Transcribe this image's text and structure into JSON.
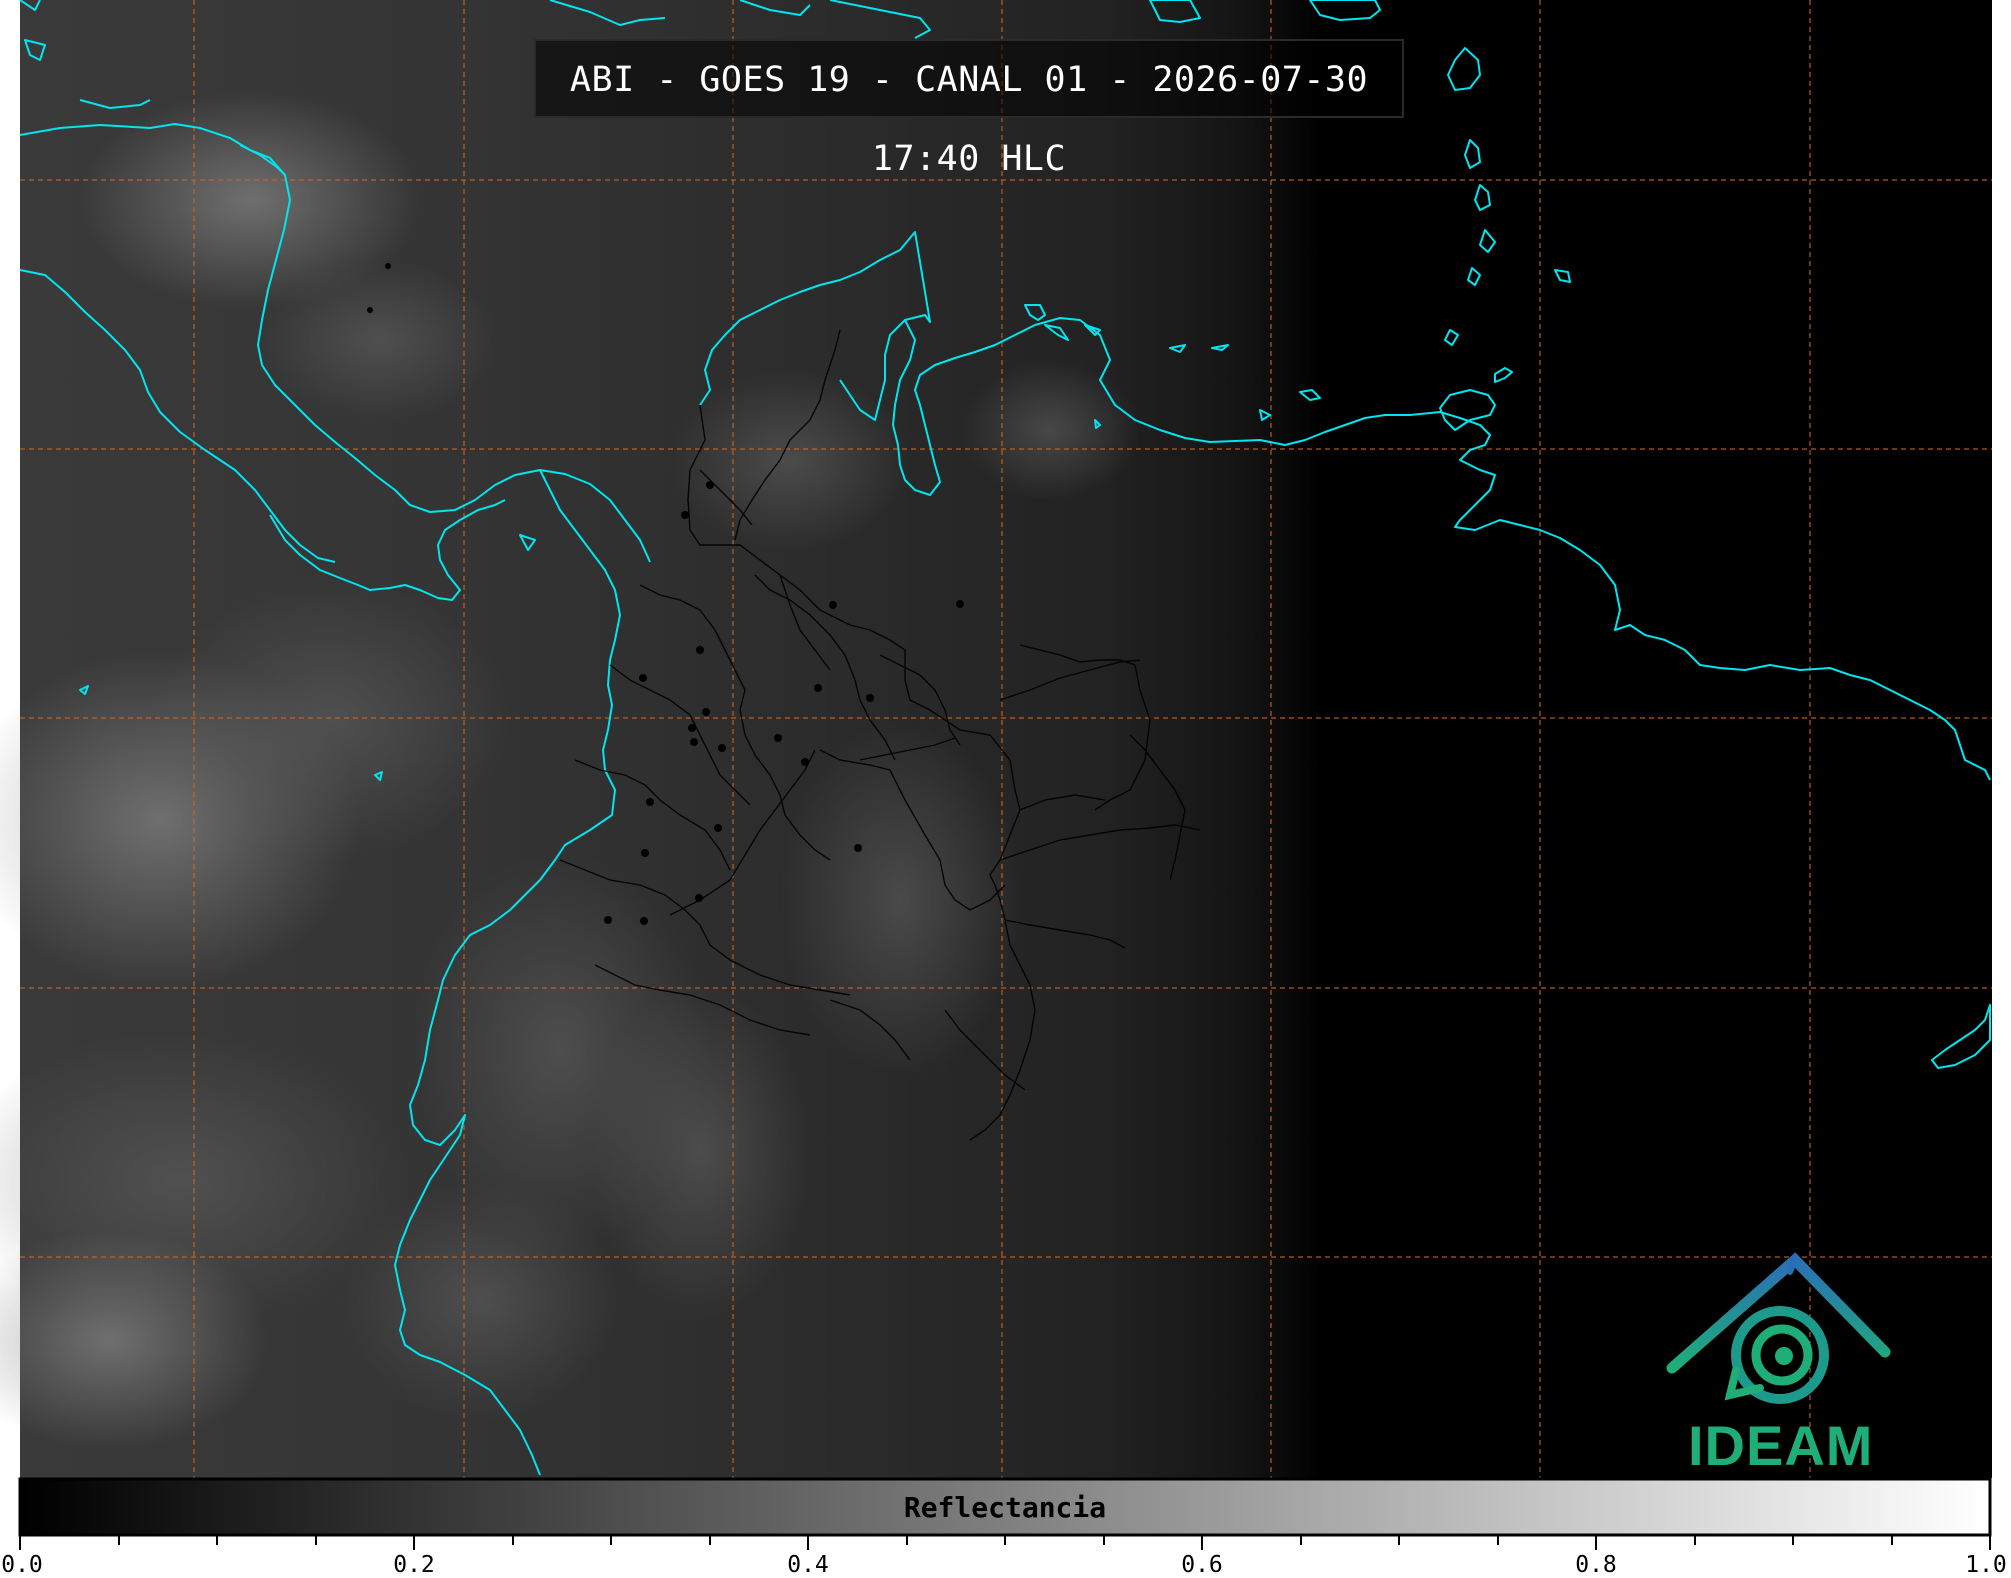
{
  "title": "ABI - GOES 19 - CANAL 01 - 2026-07-30 17:40 HLC",
  "colorbar": {
    "label": "Reflectancia",
    "ticks": [
      "0.0",
      "0.2",
      "0.4",
      "0.6",
      "0.8",
      "1.0"
    ],
    "range": [
      0.0,
      1.0
    ]
  },
  "logo": {
    "text": "IDEAM"
  },
  "colors": {
    "coastline": "#00e5ee",
    "gridlines": "#d2691e",
    "borders": "#000000",
    "logo_blue": "#2a6fb5",
    "logo_green": "#1fae78"
  }
}
